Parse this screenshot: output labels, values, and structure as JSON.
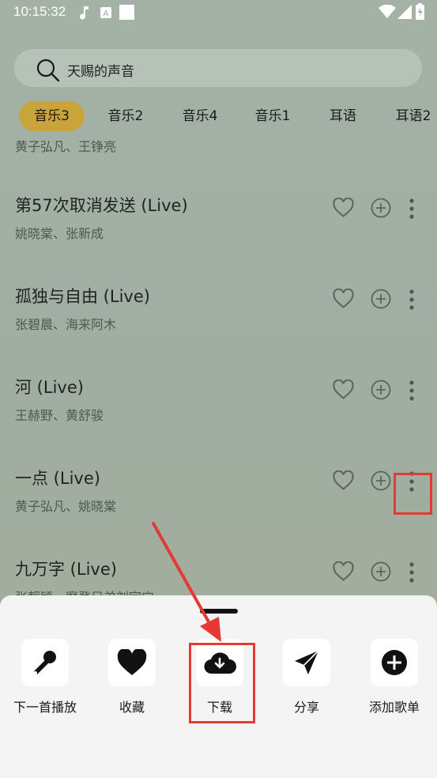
{
  "status_bar": {
    "time": "10:15:32"
  },
  "search": {
    "placeholder": "天赐的声音"
  },
  "tabs": [
    {
      "label": "音乐3",
      "active": true
    },
    {
      "label": "音乐2"
    },
    {
      "label": "音乐4"
    },
    {
      "label": "音乐1"
    },
    {
      "label": "耳语"
    },
    {
      "label": "耳语2"
    }
  ],
  "list": {
    "partial_artist": "黄子弘凡、王铮亮",
    "songs": [
      {
        "title": "第57次取消发送 (Live)",
        "artist": "姚晓棠、张新成"
      },
      {
        "title": "孤独与自由 (Live)",
        "artist": "张碧晨、海来阿木"
      },
      {
        "title": "河 (Live)",
        "artist": "王赫野、黄舒骏"
      },
      {
        "title": "一点 (Live)",
        "artist": "黄子弘凡、姚晓棠"
      },
      {
        "title": "九万字 (Live)",
        "artist": "张靓颖、摩登兄弟刘宇宁"
      }
    ]
  },
  "sheet": {
    "actions": [
      {
        "label": "下一首播放",
        "icon": "microphone-icon"
      },
      {
        "label": "收藏",
        "icon": "heart-icon"
      },
      {
        "label": "下载",
        "icon": "cloud-download-icon"
      },
      {
        "label": "分享",
        "icon": "paper-plane-icon"
      },
      {
        "label": "添加歌单",
        "icon": "plus-circle-icon"
      }
    ]
  },
  "colors": {
    "highlight": "#e53935",
    "active_tab": "#c8a43a",
    "sheet_bg": "#f4f4f4"
  }
}
